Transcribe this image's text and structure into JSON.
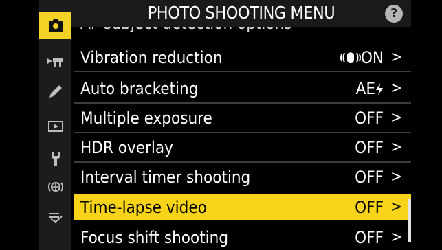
{
  "header": {
    "title": "PHOTO SHOOTING MENU",
    "help": "?"
  },
  "sidebar": {
    "tabs": [
      {
        "icon": "camera-icon",
        "active": true
      },
      {
        "icon": "movie-icon",
        "active": false
      },
      {
        "icon": "pencil-icon",
        "active": false
      },
      {
        "icon": "playback-icon",
        "active": false
      },
      {
        "icon": "wrench-icon",
        "active": false
      },
      {
        "icon": "network-icon",
        "active": false
      },
      {
        "icon": "my-menu-icon",
        "active": false
      }
    ]
  },
  "menu": {
    "partial_item": "AF subject detection options",
    "items": [
      {
        "label": "Vibration reduction",
        "value": "ON",
        "value_icon": "vibration-hand-icon"
      },
      {
        "label": "Auto bracketing",
        "value": "AE",
        "value_icon": "flash-bolt-icon"
      },
      {
        "label": "Multiple exposure",
        "value": "OFF"
      },
      {
        "label": "HDR overlay",
        "value": "OFF"
      },
      {
        "label": "Interval timer shooting",
        "value": "OFF"
      },
      {
        "label": "Time-lapse video",
        "value": "OFF",
        "selected": true
      },
      {
        "label": "Focus shift shooting",
        "value": "OFF"
      }
    ],
    "chevron": ">"
  },
  "colors": {
    "accent": "#f7d419",
    "background": "#000000",
    "sidebar": "#1c1c1c"
  }
}
